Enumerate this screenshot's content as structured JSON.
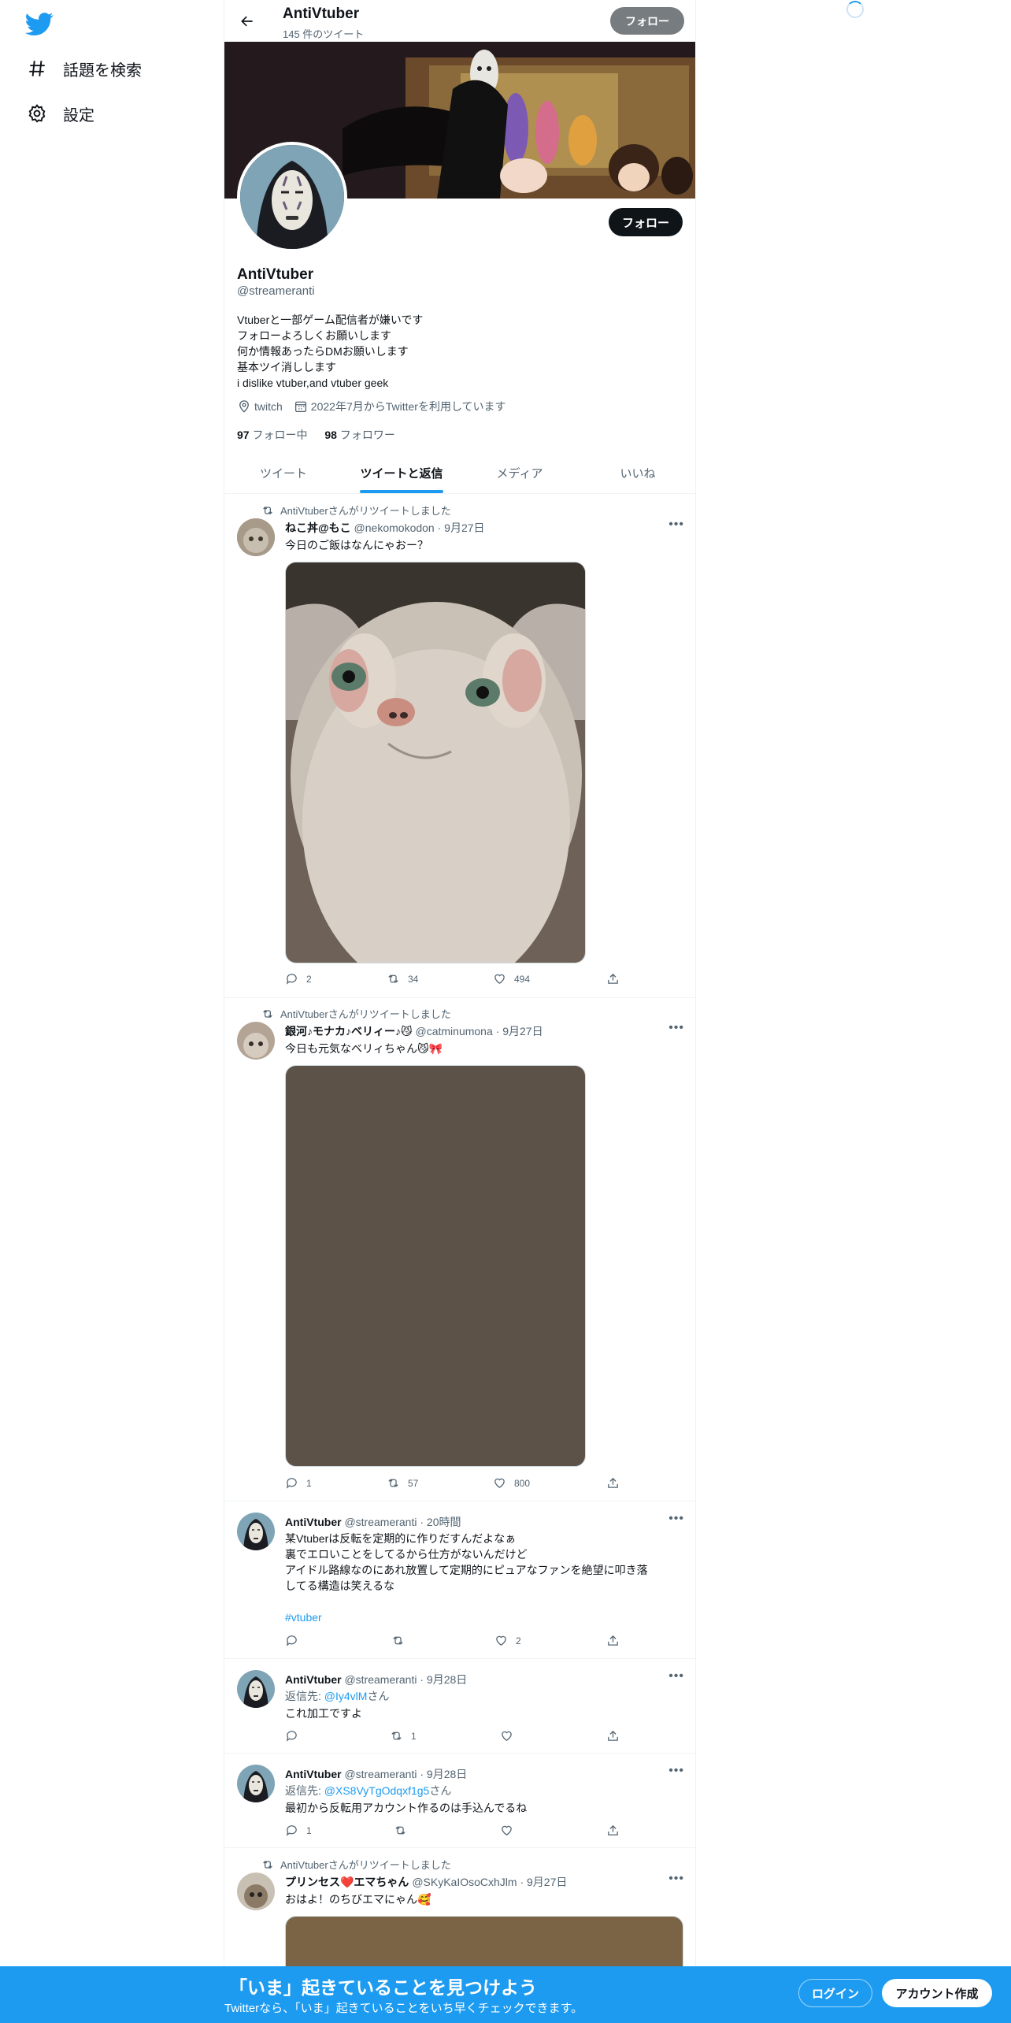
{
  "nav": {
    "items": [
      {
        "label": "話題を検索",
        "icon": "hashtag-icon"
      },
      {
        "label": "設定",
        "icon": "gear-icon"
      }
    ]
  },
  "header": {
    "name": "AntiVtuber",
    "tweet_count": "145 件のツイート",
    "follow_label": "フォロー"
  },
  "profile": {
    "name": "AntiVtuber",
    "handle": "@streameranti",
    "follow_label": "フォロー",
    "bio": [
      "Vtuberと一部ゲーム配信者が嫌いです",
      "フォローよろしくお願いします",
      "何か情報あったらDMお願いします",
      "基本ツイ消しします",
      "i dislike vtuber,and vtuber geek"
    ],
    "location": "twitch",
    "joined": "2022年7月からTwitterを利用しています",
    "following_count": "97",
    "following_label": "フォロー中",
    "followers_count": "98",
    "followers_label": "フォロワー"
  },
  "tabs": [
    {
      "label": "ツイート",
      "active": false
    },
    {
      "label": "ツイートと返信",
      "active": true
    },
    {
      "label": "メディア",
      "active": false
    },
    {
      "label": "いいね",
      "active": false
    }
  ],
  "tweets": [
    {
      "retweet_label": "AntiVtuberさんがリツイートしました",
      "name": "ねこ丼@もこ",
      "handle": "@nekomokodon",
      "date": "· 9月27日",
      "text": [
        "今日のご飯はなんにゃおー？"
      ],
      "replies": "2",
      "retweets": "34",
      "likes": "494"
    },
    {
      "retweet_label": "AntiVtuberさんがリツイートしました",
      "name": "銀河♪モナカ♪ベリィー♪😼",
      "handle": "@catminumona",
      "date": "· 9月27日",
      "text": [
        "今日も元気なベリィちゃん😼🎀"
      ],
      "replies": "1",
      "retweets": "57",
      "likes": "800"
    },
    {
      "name": "AntiVtuber",
      "handle": "@streameranti",
      "date": "· 20時間",
      "text": [
        "某Vtuberは反転を定期的に作りだすんだよなぁ",
        "裏でエロいことをしてるから仕方がないんだけど",
        "アイドル路線なのにあれ放置して定期的にピュアなファンを絶望に叩き落",
        "してる構造は笑えるな"
      ],
      "hashtag": "#vtuber",
      "replies": "",
      "retweets": "",
      "likes": "2"
    },
    {
      "name": "AntiVtuber",
      "handle": "@streameranti",
      "date": "· 9月28日",
      "reply_prefix": "返信先: ",
      "reply_to": "@Iy4vlM",
      "reply_suffix": "さん",
      "text": [
        "これ加工ですよ"
      ],
      "replies": "",
      "retweets": "1",
      "likes": ""
    },
    {
      "name": "AntiVtuber",
      "handle": "@streameranti",
      "date": "· 9月28日",
      "reply_prefix": "返信先: ",
      "reply_to": "@XS8VyTgOdqxf1g5",
      "reply_suffix": "さん",
      "text": [
        "最初から反転用アカウント作るのは手込んでるね"
      ],
      "replies": "1",
      "retweets": "",
      "likes": ""
    },
    {
      "retweet_label": "AntiVtuberさんがリツイートしました",
      "name": "プリンセス❤️エマちゃん",
      "handle": "@SKyKaIOsoCxhJlm",
      "date": "· 9月27日",
      "text": [
        "おはよ！のちびエマにゃん🥰"
      ]
    }
  ],
  "bottom_bar": {
    "title": "「いま」起きていることを見つけよう",
    "subtitle": "Twitterなら、「いま」起きていることをいち早くチェックできます。",
    "login": "ログイン",
    "signup": "アカウント作成"
  }
}
